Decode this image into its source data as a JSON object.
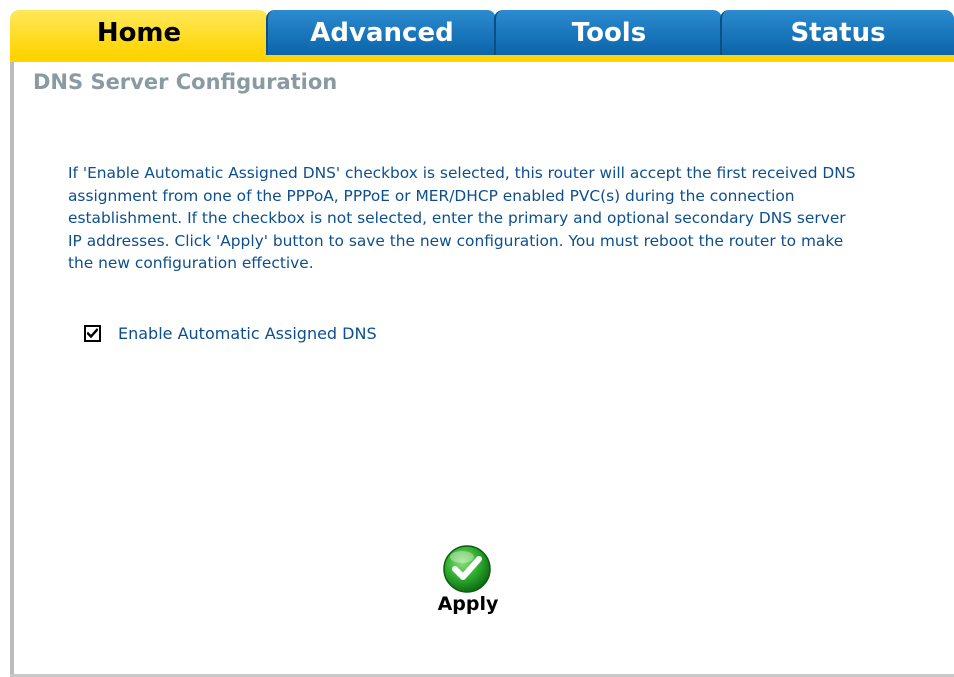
{
  "tabs": [
    {
      "label": "Home",
      "active": true
    },
    {
      "label": "Advanced",
      "active": false
    },
    {
      "label": "Tools",
      "active": false
    },
    {
      "label": "Status",
      "active": false
    }
  ],
  "colors": {
    "tab_active": "#ffd400",
    "tab_inactive": "#1a74bb",
    "title_text": "#8a9aa3",
    "body_text": "#0d4f8e",
    "apply_green": "#2fae2f"
  },
  "page": {
    "title": "DNS Server Configuration",
    "description": "If 'Enable Automatic Assigned DNS' checkbox is selected, this router will accept the first received DNS assignment from one of the PPPoA, PPPoE or MER/DHCP enabled PVC(s) during the connection establishment. If the checkbox is not selected, enter the primary and optional secondary DNS server IP addresses. Click 'Apply' button to save the new configuration. You must reboot the router to make the new configuration effective."
  },
  "auto_dns": {
    "label": "Enable Automatic Assigned DNS",
    "checked": true
  },
  "apply": {
    "label": "Apply",
    "icon": "checkmark-icon"
  }
}
